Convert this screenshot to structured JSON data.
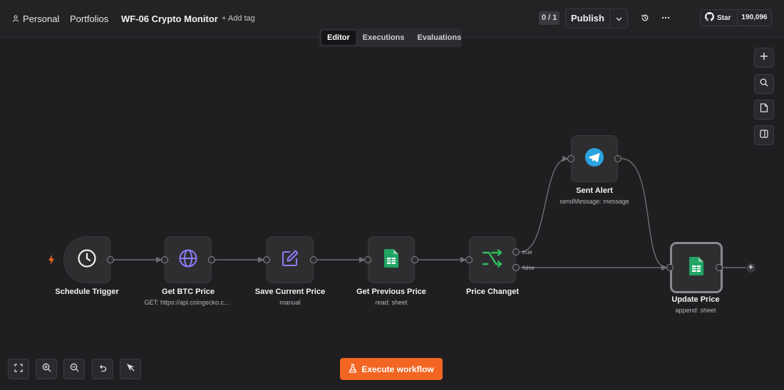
{
  "header": {
    "project": "Personal",
    "folder": "Portfolios",
    "workflow_title": "WF-06 Crypto Monitor",
    "add_tag": "+ Add tag",
    "version_counter": "0 / 1",
    "publish_label": "Publish",
    "github_star_label": "Star",
    "github_star_count": "190,096"
  },
  "tabs": [
    {
      "label": "Editor",
      "active": true
    },
    {
      "label": "Executions",
      "active": false
    },
    {
      "label": "Evaluations",
      "active": false
    }
  ],
  "nodes": [
    {
      "id": "schedule",
      "label": "Schedule Trigger",
      "subtitle": "",
      "icon": "clock-icon"
    },
    {
      "id": "get-btc",
      "label": "Get BTC Price",
      "subtitle": "GET: https://api.coingecko.c...",
      "icon": "globe-icon"
    },
    {
      "id": "save-current",
      "label": "Save Current Price",
      "subtitle": "manual",
      "icon": "edit-icon"
    },
    {
      "id": "get-previous",
      "label": "Get Previous Price",
      "subtitle": "read: sheet",
      "icon": "sheets-icon"
    },
    {
      "id": "price-changed",
      "label": "Price Changet",
      "subtitle": "",
      "icon": "if-branch-icon"
    },
    {
      "id": "sent-alert",
      "label": "Sent Alert",
      "subtitle": "sendMessage: message",
      "icon": "telegram-icon"
    },
    {
      "id": "update-price",
      "label": "Update Price",
      "subtitle": "append: sheet",
      "icon": "sheets-icon"
    }
  ],
  "branch_labels": {
    "true": "true",
    "false": "false"
  },
  "execute_button": "Execute workflow",
  "colors": {
    "accent": "#f26522",
    "trigger_bolt": "#f26522",
    "sheets_green": "#21a464",
    "telegram_blue": "#2aa3df",
    "if_green": "#2fbf5a",
    "edit_purple": "#8b7cf6",
    "globe_purple": "#8b7cf6"
  }
}
